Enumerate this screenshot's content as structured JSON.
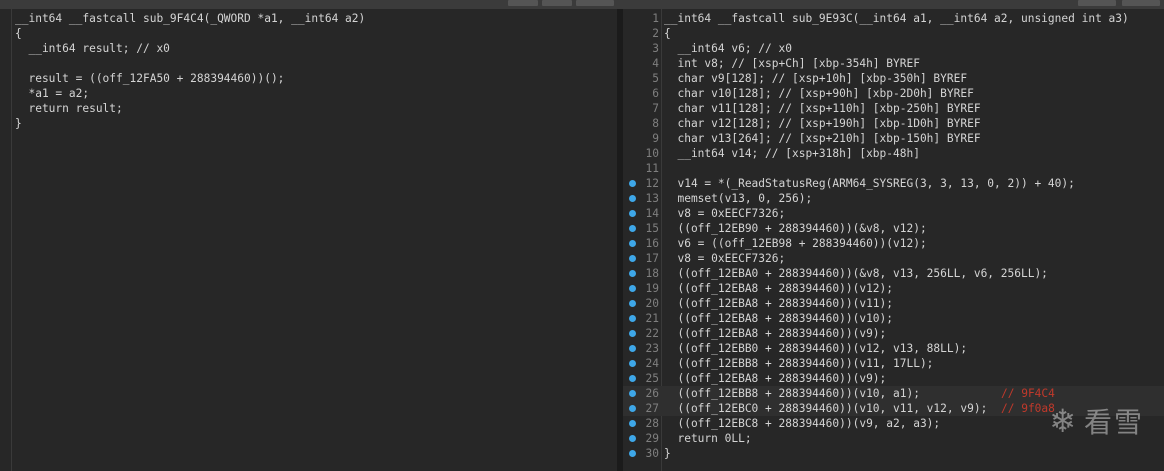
{
  "left": {
    "lines": [
      "__int64 __fastcall sub_9F4C4(_QWORD *a1, __int64 a2)",
      "{",
      "  __int64 result; // x0",
      "",
      "  result = ((off_12FA50 + 288394460))();",
      "  *a1 = a2;",
      "  return result;",
      "}"
    ]
  },
  "right": {
    "lines": [
      {
        "n": "1",
        "code": "__int64 __fastcall sub_9E93C(__int64 a1, __int64 a2, unsigned int a3)",
        "bp": false
      },
      {
        "n": "2",
        "code": "{",
        "bp": false
      },
      {
        "n": "3",
        "code": "  __int64 v6; // x0",
        "bp": false
      },
      {
        "n": "4",
        "code": "  int v8; // [xsp+Ch] [xbp-354h] BYREF",
        "bp": false
      },
      {
        "n": "5",
        "code": "  char v9[128]; // [xsp+10h] [xbp-350h] BYREF",
        "bp": false
      },
      {
        "n": "6",
        "code": "  char v10[128]; // [xsp+90h] [xbp-2D0h] BYREF",
        "bp": false
      },
      {
        "n": "7",
        "code": "  char v11[128]; // [xsp+110h] [xbp-250h] BYREF",
        "bp": false
      },
      {
        "n": "8",
        "code": "  char v12[128]; // [xsp+190h] [xbp-1D0h] BYREF",
        "bp": false
      },
      {
        "n": "9",
        "code": "  char v13[264]; // [xsp+210h] [xbp-150h] BYREF",
        "bp": false
      },
      {
        "n": "10",
        "code": "  __int64 v14; // [xsp+318h] [xbp-48h]",
        "bp": false
      },
      {
        "n": "11",
        "code": "",
        "bp": false
      },
      {
        "n": "12",
        "code": "  v14 = *(_ReadStatusReg(ARM64_SYSREG(3, 3, 13, 0, 2)) + 40);",
        "bp": true
      },
      {
        "n": "13",
        "code": "  memset(v13, 0, 256);",
        "bp": true
      },
      {
        "n": "14",
        "code": "  v8 = 0xEECF7326;",
        "bp": true
      },
      {
        "n": "15",
        "code": "  ((off_12EB90 + 288394460))(&v8, v12);",
        "bp": true
      },
      {
        "n": "16",
        "code": "  v6 = ((off_12EB98 + 288394460))(v12);",
        "bp": true
      },
      {
        "n": "17",
        "code": "  v8 = 0xEECF7326;",
        "bp": true
      },
      {
        "n": "18",
        "code": "  ((off_12EBA0 + 288394460))(&v8, v13, 256LL, v6, 256LL);",
        "bp": true
      },
      {
        "n": "19",
        "code": "  ((off_12EBA8 + 288394460))(v12);",
        "bp": true
      },
      {
        "n": "20",
        "code": "  ((off_12EBA8 + 288394460))(v11);",
        "bp": true
      },
      {
        "n": "21",
        "code": "  ((off_12EBA8 + 288394460))(v10);",
        "bp": true
      },
      {
        "n": "22",
        "code": "  ((off_12EBA8 + 288394460))(v9);",
        "bp": true
      },
      {
        "n": "23",
        "code": "  ((off_12EBB0 + 288394460))(v12, v13, 88LL);",
        "bp": true
      },
      {
        "n": "24",
        "code": "  ((off_12EBB8 + 288394460))(v11, 17LL);",
        "bp": true
      },
      {
        "n": "25",
        "code": "  ((off_12EBA8 + 288394460))(v9);",
        "bp": true
      },
      {
        "n": "26",
        "code": "  ((off_12EBB8 + 288394460))(v10, a1);",
        "bp": true,
        "comment": "// 9F4C4"
      },
      {
        "n": "27",
        "code": "  ((off_12EBC0 + 288394460))(v10, v11, v12, v9);",
        "bp": true,
        "comment": "// 9f0a8"
      },
      {
        "n": "28",
        "code": "  ((off_12EBC8 + 288394460))(v9, a2, a3);",
        "bp": true
      },
      {
        "n": "29",
        "code": "  return 0LL;",
        "bp": true
      },
      {
        "n": "30",
        "code": "}",
        "bp": true
      }
    ]
  },
  "watermark": {
    "icon": "snowflake-icon",
    "text": "看雪"
  }
}
